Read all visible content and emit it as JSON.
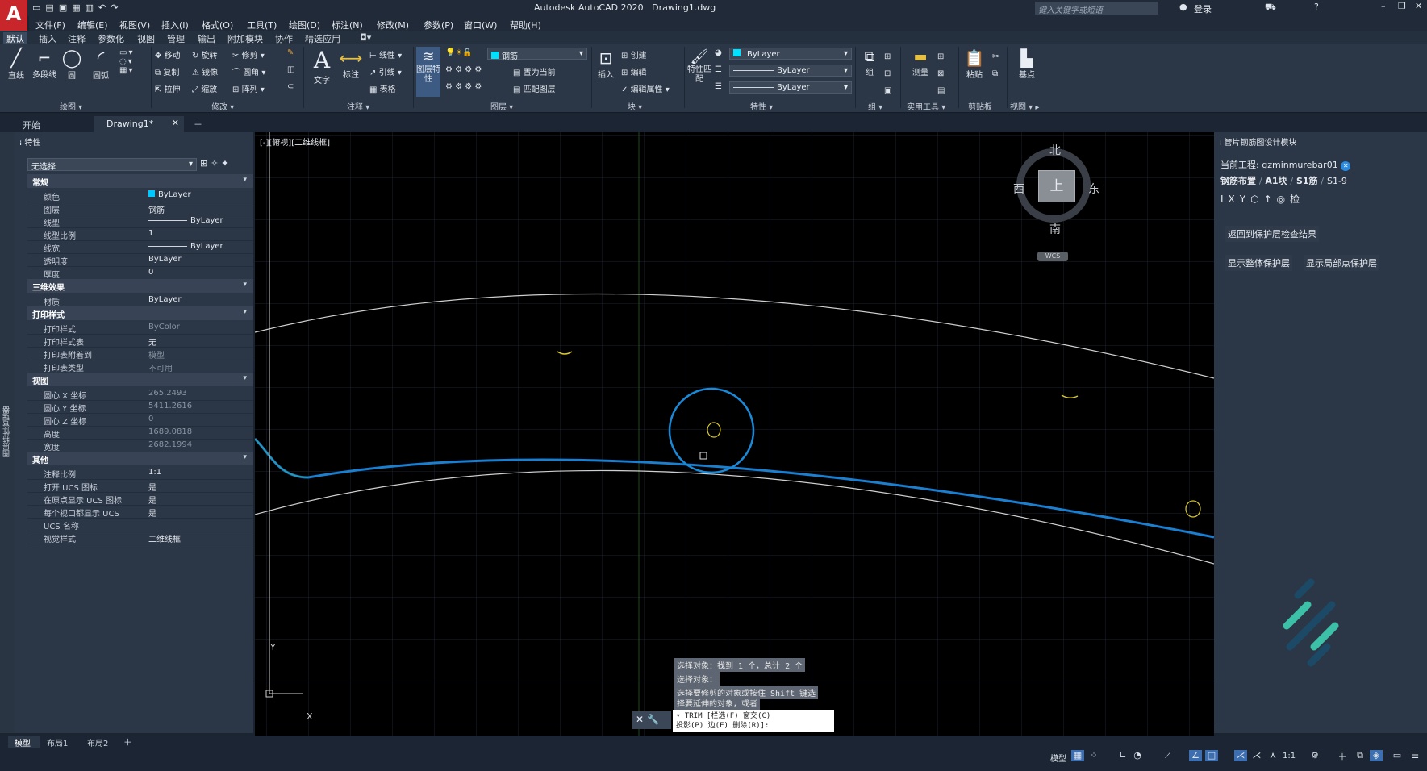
{
  "app": {
    "title": "Autodesk AutoCAD 2020",
    "document": "Drawing1.dwg",
    "logo": "A"
  },
  "search": {
    "placeholder": "键入关键字或短语"
  },
  "user": {
    "login": "登录"
  },
  "menu": [
    "文件(F)",
    "编辑(E)",
    "视图(V)",
    "插入(I)",
    "格式(O)",
    "工具(T)",
    "绘图(D)",
    "标注(N)",
    "修改(M)",
    "参数(P)",
    "窗口(W)",
    "帮助(H)"
  ],
  "ribbon_tabs": [
    "默认",
    "插入",
    "注释",
    "参数化",
    "视图",
    "管理",
    "输出",
    "附加模块",
    "协作",
    "精选应用"
  ],
  "ribbon": {
    "draw": {
      "line": "直线",
      "polyline": "多段线",
      "circle": "圆",
      "arc": "圆弧",
      "section": "绘图"
    },
    "modify": {
      "move": "移动",
      "rotate": "旋转",
      "trim": "修剪",
      "copy": "复制",
      "mirror": "镜像",
      "fillet": "圆角",
      "stretch": "拉伸",
      "scale": "缩放",
      "array": "阵列",
      "section": "修改"
    },
    "annotation": {
      "text": "文字",
      "dimension": "标注",
      "linear": "线性",
      "leader": "引线",
      "table": "表格",
      "section": "注释"
    },
    "layers": {
      "properties": "图层特性",
      "current_layer": "钢筋",
      "set_current": "置为当前",
      "match_layer": "匹配图层",
      "section": "图层"
    },
    "block": {
      "insert": "插入",
      "create": "创建",
      "edit": "编辑",
      "edit_attr": "编辑属性",
      "section": "块"
    },
    "properties": {
      "match": "特性匹配",
      "color": "ByLayer",
      "linetype": "ByLayer",
      "lineweight": "ByLayer",
      "section": "特性"
    },
    "groups": {
      "group": "组",
      "section": "组"
    },
    "utilities": {
      "measure": "测量",
      "section": "实用工具"
    },
    "clipboard": {
      "paste": "粘贴",
      "section": "剪贴板"
    },
    "view": {
      "base": "基点",
      "section": "视图"
    }
  },
  "doc_tabs": [
    "开始",
    "Drawing1*"
  ],
  "left_strip_label": "图层特性管理器",
  "props": {
    "title": "特性",
    "selection": "无选择",
    "sections": [
      {
        "name": "常规",
        "rows": [
          {
            "k": "颜色",
            "v": "ByLayer",
            "swatch": "#00c8ff"
          },
          {
            "k": "图层",
            "v": "钢筋"
          },
          {
            "k": "线型",
            "v": "ByLayer",
            "line": true
          },
          {
            "k": "线型比例",
            "v": "1"
          },
          {
            "k": "线宽",
            "v": "ByLayer",
            "line": true
          },
          {
            "k": "透明度",
            "v": "ByLayer"
          },
          {
            "k": "厚度",
            "v": "0"
          }
        ]
      },
      {
        "name": "三维效果",
        "rows": [
          {
            "k": "材质",
            "v": "ByLayer"
          }
        ]
      },
      {
        "name": "打印样式",
        "rows": [
          {
            "k": "打印样式",
            "v": "ByColor",
            "dim": true
          },
          {
            "k": "打印样式表",
            "v": "无"
          },
          {
            "k": "打印表附着到",
            "v": "模型",
            "dim": true
          },
          {
            "k": "打印表类型",
            "v": "不可用",
            "dim": true
          }
        ]
      },
      {
        "name": "视图",
        "rows": [
          {
            "k": "圆心 X 坐标",
            "v": "265.2493",
            "dim": true
          },
          {
            "k": "圆心 Y 坐标",
            "v": "5411.2616",
            "dim": true
          },
          {
            "k": "圆心 Z 坐标",
            "v": "0",
            "dim": true
          },
          {
            "k": "高度",
            "v": "1689.0818",
            "dim": true
          },
          {
            "k": "宽度",
            "v": "2682.1994",
            "dim": true
          }
        ]
      },
      {
        "name": "其他",
        "rows": [
          {
            "k": "注释比例",
            "v": "1:1"
          },
          {
            "k": "打开 UCS 图标",
            "v": "是"
          },
          {
            "k": "在原点显示 UCS 图标",
            "v": "是"
          },
          {
            "k": "每个视口都显示 UCS",
            "v": "是"
          },
          {
            "k": "UCS 名称",
            "v": ""
          },
          {
            "k": "视觉样式",
            "v": "二维线框"
          }
        ]
      }
    ]
  },
  "viewport": {
    "label": "[-][俯视][二维线框]"
  },
  "viewcube": {
    "north": "北",
    "south": "南",
    "east": "东",
    "west": "西",
    "top": "上",
    "wcs": "WCS"
  },
  "ucs": {
    "y": "Y",
    "x": "X"
  },
  "command": {
    "history": [
      "选择对象：找到 1 个，总计 2 个",
      "选择对象：",
      "选择要修剪的对象或按住 Shift 键选",
      "择要延伸的对象，或者"
    ],
    "prompt_line1": "TRIM [栏选(F) 窗交(C)",
    "prompt_line2": "投影(P) 边(E) 删除(R)]:"
  },
  "right_panel": {
    "title": "管片钢筋图设计模块",
    "project_label": "当前工程:",
    "project_name": "gzminmurebar01",
    "breadcrumb": [
      "钢筋布置",
      "A1块",
      "S1筋",
      "S1-9"
    ],
    "tools": [
      "IXY",
      "检"
    ],
    "buttons": [
      "返回到保护层检查结果",
      "显示整体保护层",
      "显示局部点保护层"
    ]
  },
  "layout_tabs": [
    "模型",
    "布局1",
    "布局2"
  ],
  "status": {
    "model": "模型",
    "scale": "1:1"
  }
}
